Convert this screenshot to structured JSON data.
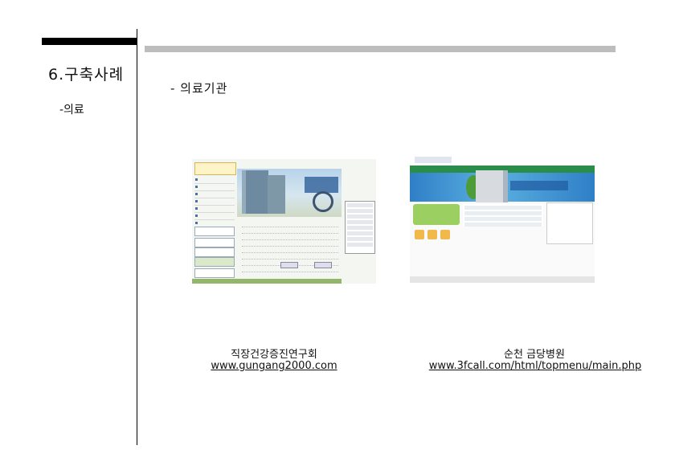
{
  "slide": {
    "section_title": "6.구축사례",
    "sub_label": "-의료",
    "heading": "- 의료기관"
  },
  "examples": [
    {
      "name": "직장건강증진연구회",
      "url": "www.gungang2000.com"
    },
    {
      "name": "순천 금당병원",
      "url": "www.3fcall.com/html/topmenu/main.php"
    }
  ],
  "colors": {
    "accent_bar": "#000000",
    "gray_bar": "#bdbdbd",
    "hospital_green": "#2a8d4a",
    "hospital_blue": "#2f7fc7"
  }
}
